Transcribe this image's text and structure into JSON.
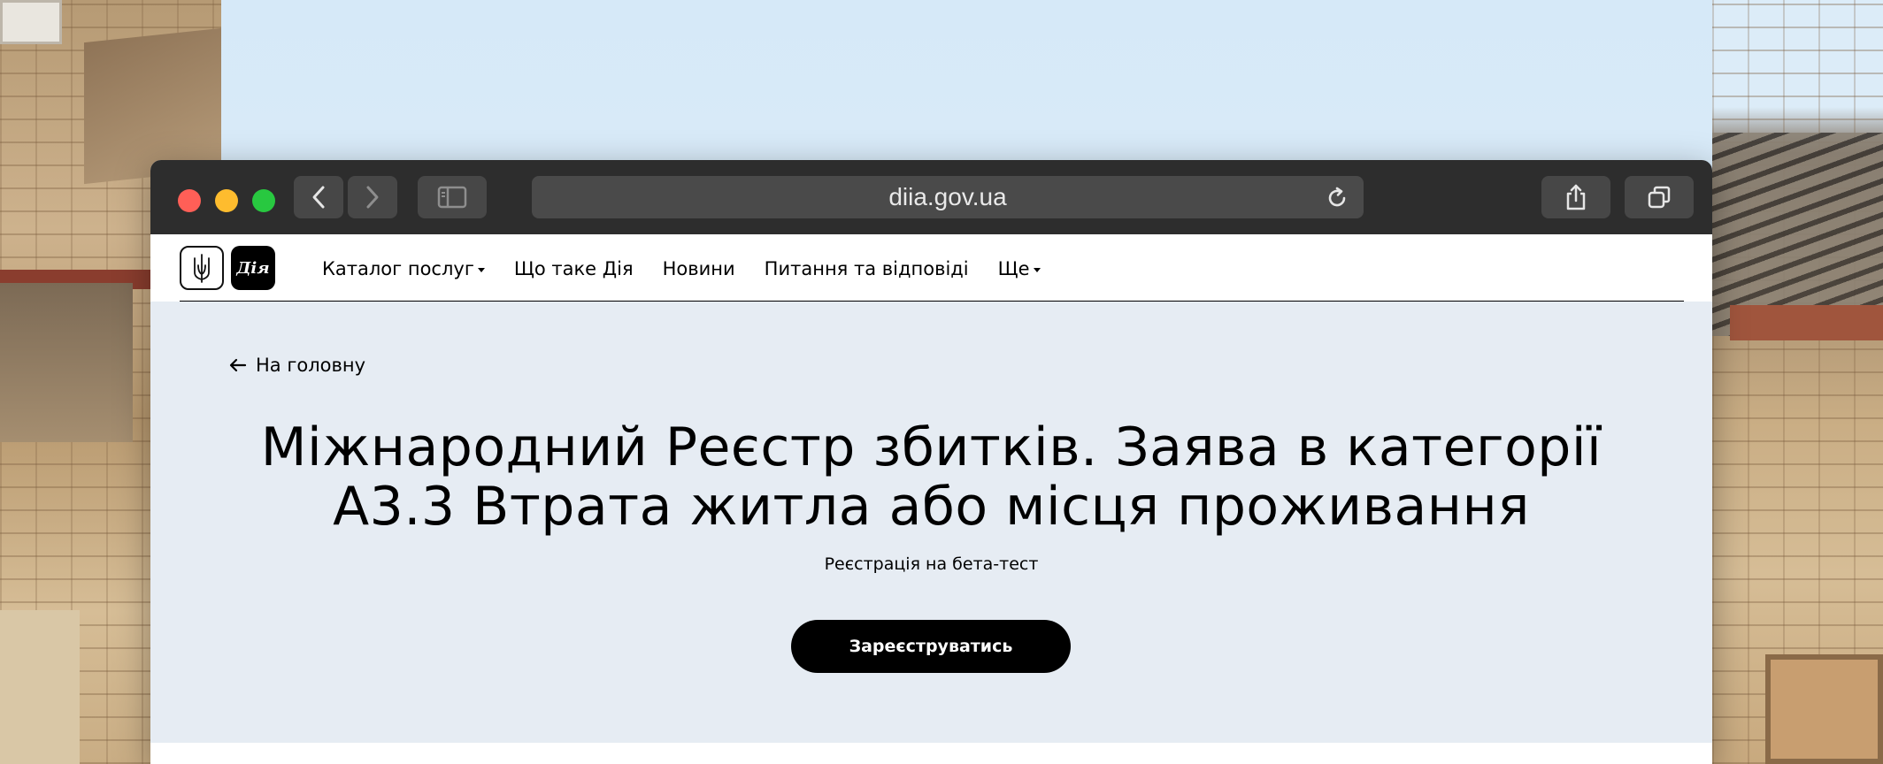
{
  "browser": {
    "url": "diia.gov.ua"
  },
  "site": {
    "logo_text": "Дія",
    "nav": [
      {
        "label": "Каталог послуг",
        "has_caret": true
      },
      {
        "label": "Що таке Дія",
        "has_caret": false
      },
      {
        "label": "Новини",
        "has_caret": false
      },
      {
        "label": "Питання та відповіді",
        "has_caret": false
      },
      {
        "label": "Ще",
        "has_caret": true
      }
    ]
  },
  "main": {
    "back_label": "На головну",
    "title_line1": "Міжнародний Реєстр збитків. Заява в категорії",
    "title_line2": "А3.3 Втрата житла або місця проживання",
    "subtitle": "Реєстрація на бета-тест",
    "cta_label": "Зареєструватись"
  },
  "colors": {
    "toolbar": "#2d2d2d",
    "page_bg": "#e6ecf3",
    "cta": "#000000"
  }
}
